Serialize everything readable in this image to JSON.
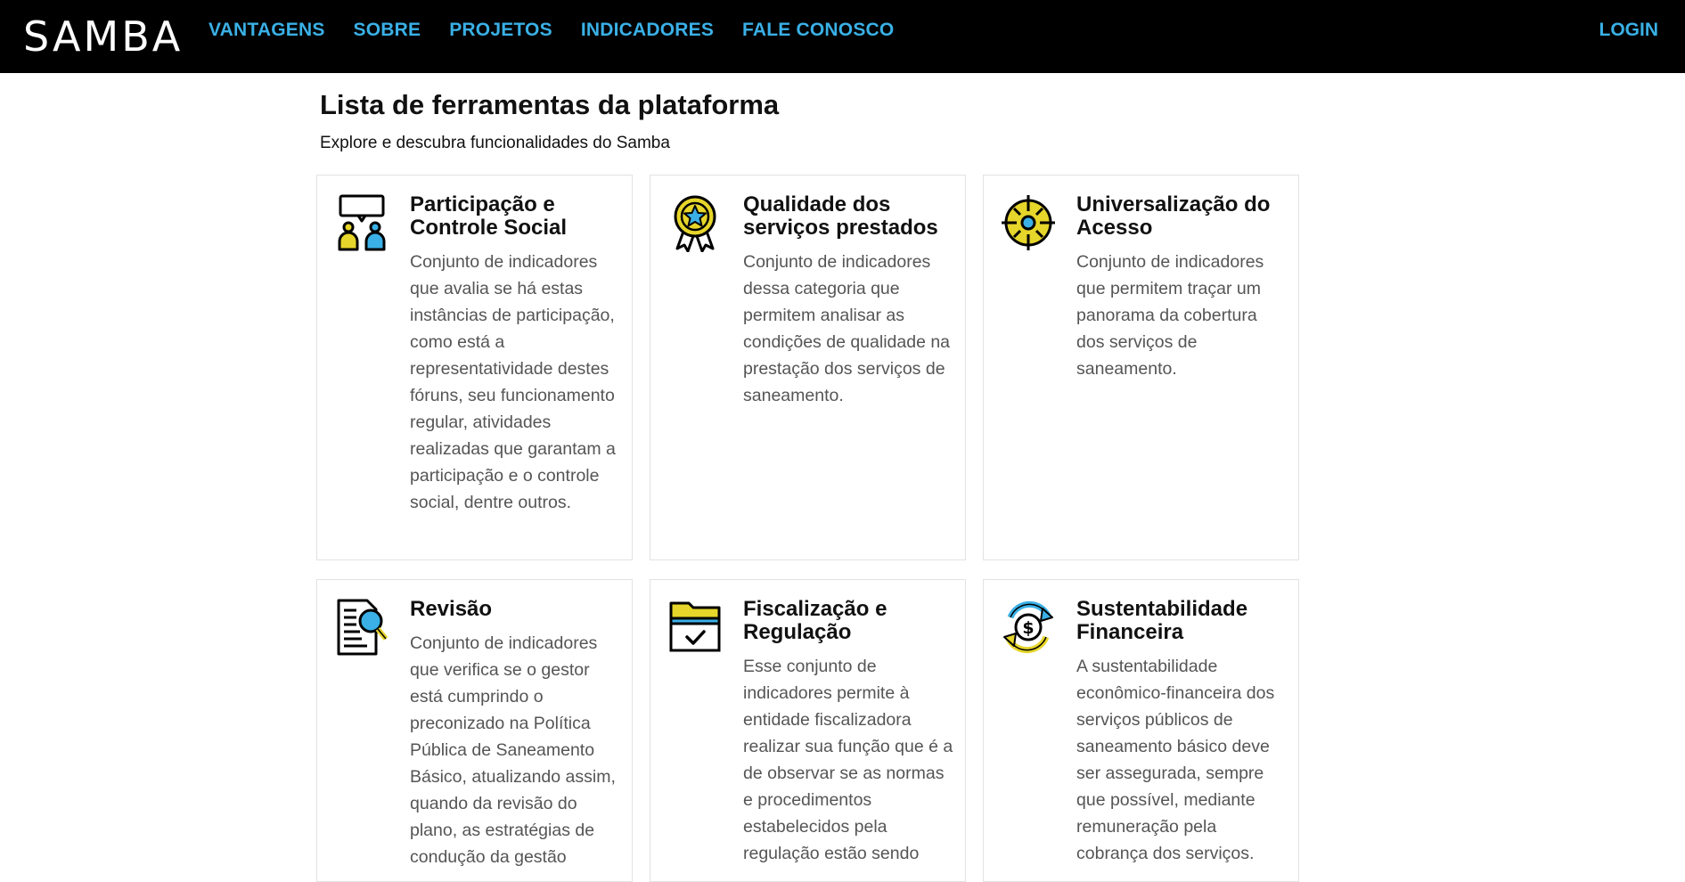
{
  "header": {
    "logo": "SAMBA",
    "nav": [
      "VANTAGENS",
      "SOBRE",
      "PROJETOS",
      "INDICADORES",
      "FALE CONOSCO"
    ],
    "login": "LOGIN"
  },
  "main": {
    "title": "Lista de ferramentas da plataforma",
    "subtitle": "Explore e descubra funcionalidades do Samba"
  },
  "cards": [
    {
      "title": "Participação e Controle Social",
      "description": "Conjunto de indicadores que avalia se há estas instâncias de participação, como está a representatividade destes fóruns, seu funcionamento regular, atividades realizadas que garantam a participação e o controle social, dentre outros.",
      "icon": "people-chat-icon"
    },
    {
      "title": "Qualidade dos serviços prestados",
      "description": "Conjunto de indicadores dessa categoria que permitem analisar as condições de qualidade na prestação dos serviços de saneamento.",
      "icon": "award-medal-icon"
    },
    {
      "title": "Universalização do Acesso",
      "description": "Conjunto de indicadores que permitem traçar um panorama da cobertura dos serviços de saneamento.",
      "icon": "target-compass-icon"
    },
    {
      "title": "Revisão",
      "description": "Conjunto de indicadores que verifica se o gestor está cumprindo o preconizado na Política Pública de Saneamento Básico, atualizando assim, quando da revisão do plano, as estratégias de condução da gestão",
      "icon": "document-search-icon"
    },
    {
      "title": "Fiscalização e Regulação",
      "description": "Esse conjunto de indicadores permite à entidade fiscalizadora realizar sua função que é a de observar se as normas e procedimentos estabelecidos pela regulação estão sendo",
      "icon": "folder-check-icon"
    },
    {
      "title": "Sustentabilidade Financeira",
      "description": "A sustentabilidade econômico-financeira dos serviços públicos de saneamento básico deve ser assegurada, sempre que possível, mediante remuneração pela cobrança dos serviços.",
      "icon": "money-cycle-icon"
    }
  ],
  "colors": {
    "nav_link": "#3ab0e6",
    "icon_yellow": "#e6d52a",
    "icon_blue": "#3ab0e6",
    "header_bg": "#000000"
  }
}
